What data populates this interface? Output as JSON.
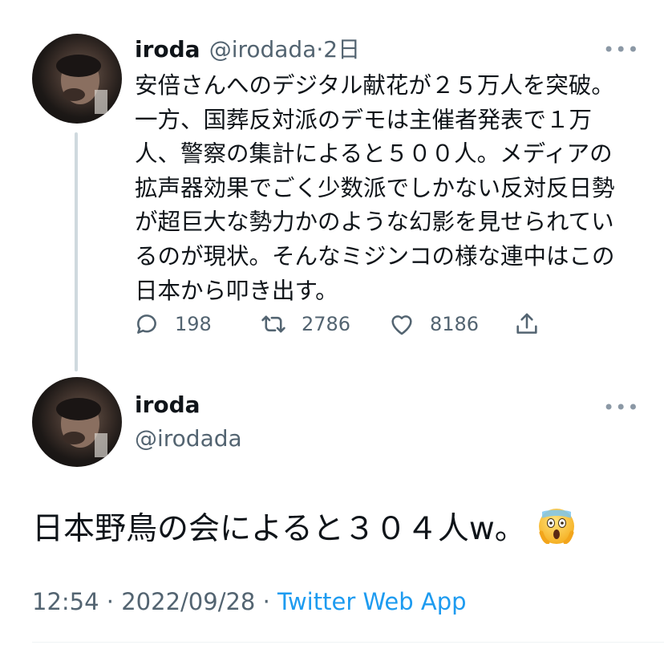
{
  "tweet1": {
    "display_name": "iroda",
    "handle": "@irodada",
    "separator": "·",
    "time": "2日",
    "body": "安倍さんへのデジタル献花が２５万人を突破。一方、国葬反対派のデモは主催者発表で１万人、警察の集計によると５００人。メディアの拡声器効果でごく少数派でしかない反対反日勢が超巨大な勢力かのような幻影を見せられているのが現状。そんなミジンコの様な連中はこの日本から叩き出す。",
    "more_icon": "more-dots-icon",
    "actions": {
      "reply": {
        "icon": "reply-icon",
        "count": "198"
      },
      "retweet": {
        "icon": "retweet-icon",
        "count": "2786"
      },
      "like": {
        "icon": "heart-icon",
        "count": "8186"
      },
      "share": {
        "icon": "share-icon"
      }
    }
  },
  "tweet2": {
    "display_name": "iroda",
    "handle": "@irodada",
    "body": "日本野鳥の会によると３０４人w。",
    "emoji": "face-screaming-in-fear",
    "time": "12:54",
    "sep1": "·",
    "date": "2022/09/28",
    "sep2": "·",
    "source": "Twitter Web App",
    "more_icon": "more-dots-icon"
  },
  "colors": {
    "text": "#0f1419",
    "secondary": "#536471",
    "link": "#1d9bf0",
    "thread_line": "#cfd9de"
  }
}
